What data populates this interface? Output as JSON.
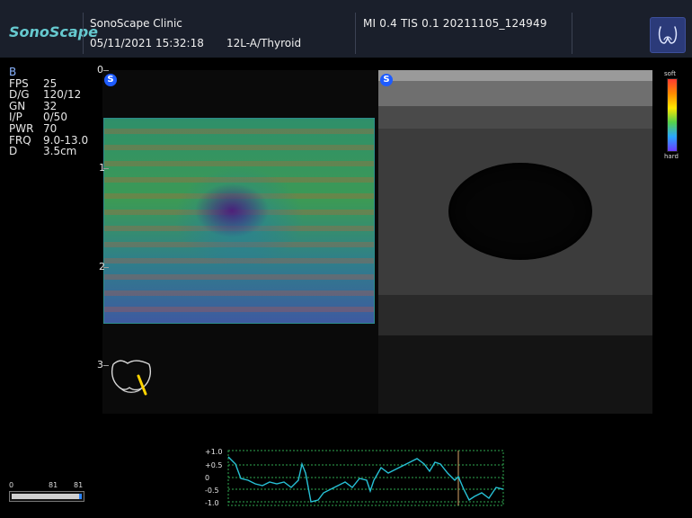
{
  "header": {
    "logo": "SonoScape",
    "clinic": "SonoScape Clinic",
    "datetime": "05/11/2021 15:32:18",
    "probe_preset": "12L-A/Thyroid",
    "mi_tis_id": "MI  0.4  TIS  0.1  20211105_124949"
  },
  "params": {
    "mode": "B",
    "rows": [
      {
        "k": "FPS",
        "v": "25"
      },
      {
        "k": "D/G",
        "v": "120/12"
      },
      {
        "k": "GN",
        "v": "32"
      },
      {
        "k": "I/P",
        "v": "0/50"
      },
      {
        "k": "PWR",
        "v": "70"
      },
      {
        "k": "FRQ",
        "v": "9.0-13.0"
      },
      {
        "k": "D",
        "v": "3.5cm"
      }
    ]
  },
  "depth_marks": [
    "0",
    "1",
    "2",
    "3"
  ],
  "pane_icons": {
    "left": "S",
    "right": "S"
  },
  "colorbar": {
    "top": "soft",
    "bottom": "hard"
  },
  "bottom_scale": {
    "left": "0",
    "mid": "81",
    "right": "81"
  },
  "trace": {
    "labels": [
      "+1.0",
      "+0.5",
      "0",
      "-0.5",
      "-1.0"
    ]
  },
  "icons": {
    "probe_marker": "probe-position-icon",
    "badge": "thyroid-icon"
  }
}
